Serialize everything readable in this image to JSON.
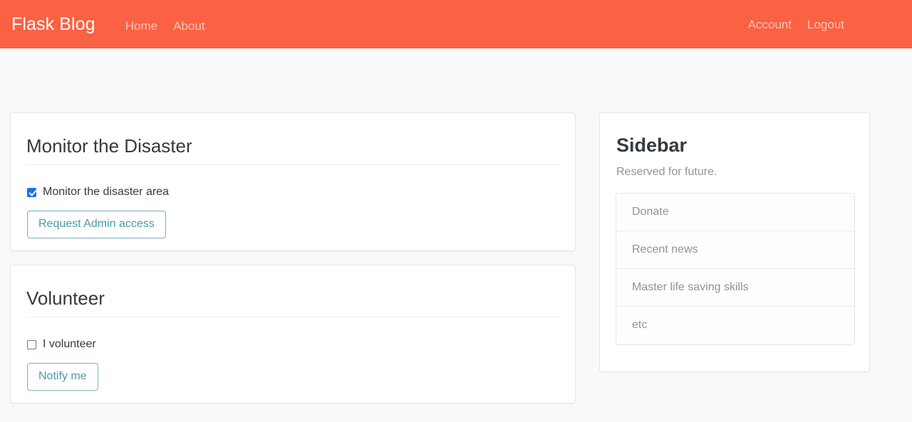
{
  "navbar": {
    "brand": "Flask Blog",
    "left_links": [
      {
        "label": "Home",
        "name": "nav-link-home"
      },
      {
        "label": "About",
        "name": "nav-link-about"
      }
    ],
    "right_links": [
      {
        "label": "Account",
        "name": "nav-link-account"
      },
      {
        "label": "Logout",
        "name": "nav-link-logout"
      }
    ],
    "background_color": "#fb6143",
    "brand_color": "#ffffff",
    "link_color": "#f3c7bb"
  },
  "main": {
    "cards": [
      {
        "title": "Monitor the Disaster",
        "checkbox_label": "Monitor the disaster area",
        "checkbox_checked": true,
        "button_label": "Request Admin access"
      },
      {
        "title": "Volunteer",
        "checkbox_label": "I volunteer",
        "checkbox_checked": false,
        "button_label": "Notify me"
      }
    ]
  },
  "sidebar": {
    "title": "Sidebar",
    "subtitle": "Reserved for future.",
    "items": [
      {
        "label": "Donate"
      },
      {
        "label": "Recent news"
      },
      {
        "label": "Master life saving skills"
      },
      {
        "label": "etc"
      }
    ]
  },
  "theme": {
    "page_background": "#f9f9f9",
    "card_background": "#ffffff",
    "card_border": "#e6e6e6",
    "accent_button": "#4a9aa6",
    "accent_button_border": "#74b4bd",
    "checkbox_checked_color": "#1a73e8",
    "muted_text": "#8d9499",
    "heading_text": "#343a40"
  }
}
